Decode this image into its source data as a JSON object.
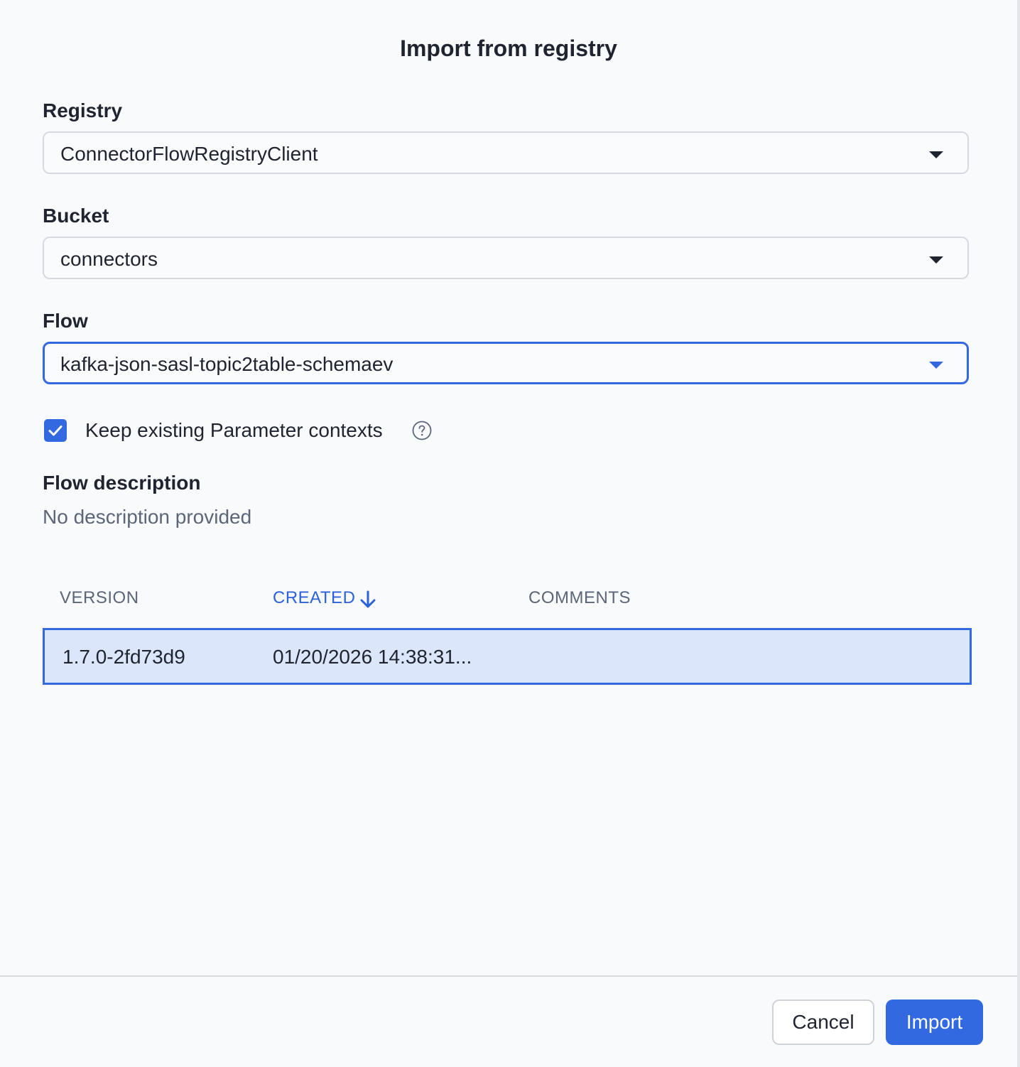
{
  "dialog": {
    "title": "Import from registry"
  },
  "registry": {
    "label": "Registry",
    "value": "ConnectorFlowRegistryClient"
  },
  "bucket": {
    "label": "Bucket",
    "value": "connectors"
  },
  "flow": {
    "label": "Flow",
    "value": "kafka-json-sasl-topic2table-schemaev"
  },
  "keep_params": {
    "label": "Keep existing Parameter contexts",
    "checked": true
  },
  "flow_description": {
    "label": "Flow description",
    "text": "No description provided"
  },
  "versions_table": {
    "columns": [
      "VERSION",
      "CREATED",
      "COMMENTS"
    ],
    "sorted_column": "CREATED",
    "sort_direction": "descending",
    "rows": [
      {
        "version": "1.7.0-2fd73d9",
        "created": "01/20/2026 14:38:31...",
        "comments": "",
        "selected": true
      }
    ]
  },
  "footer": {
    "cancel_label": "Cancel",
    "import_label": "Import"
  },
  "colors": {
    "accent": "#3369e0",
    "selected_row_bg": "#dbe6fb",
    "muted_text": "#5c6678"
  }
}
